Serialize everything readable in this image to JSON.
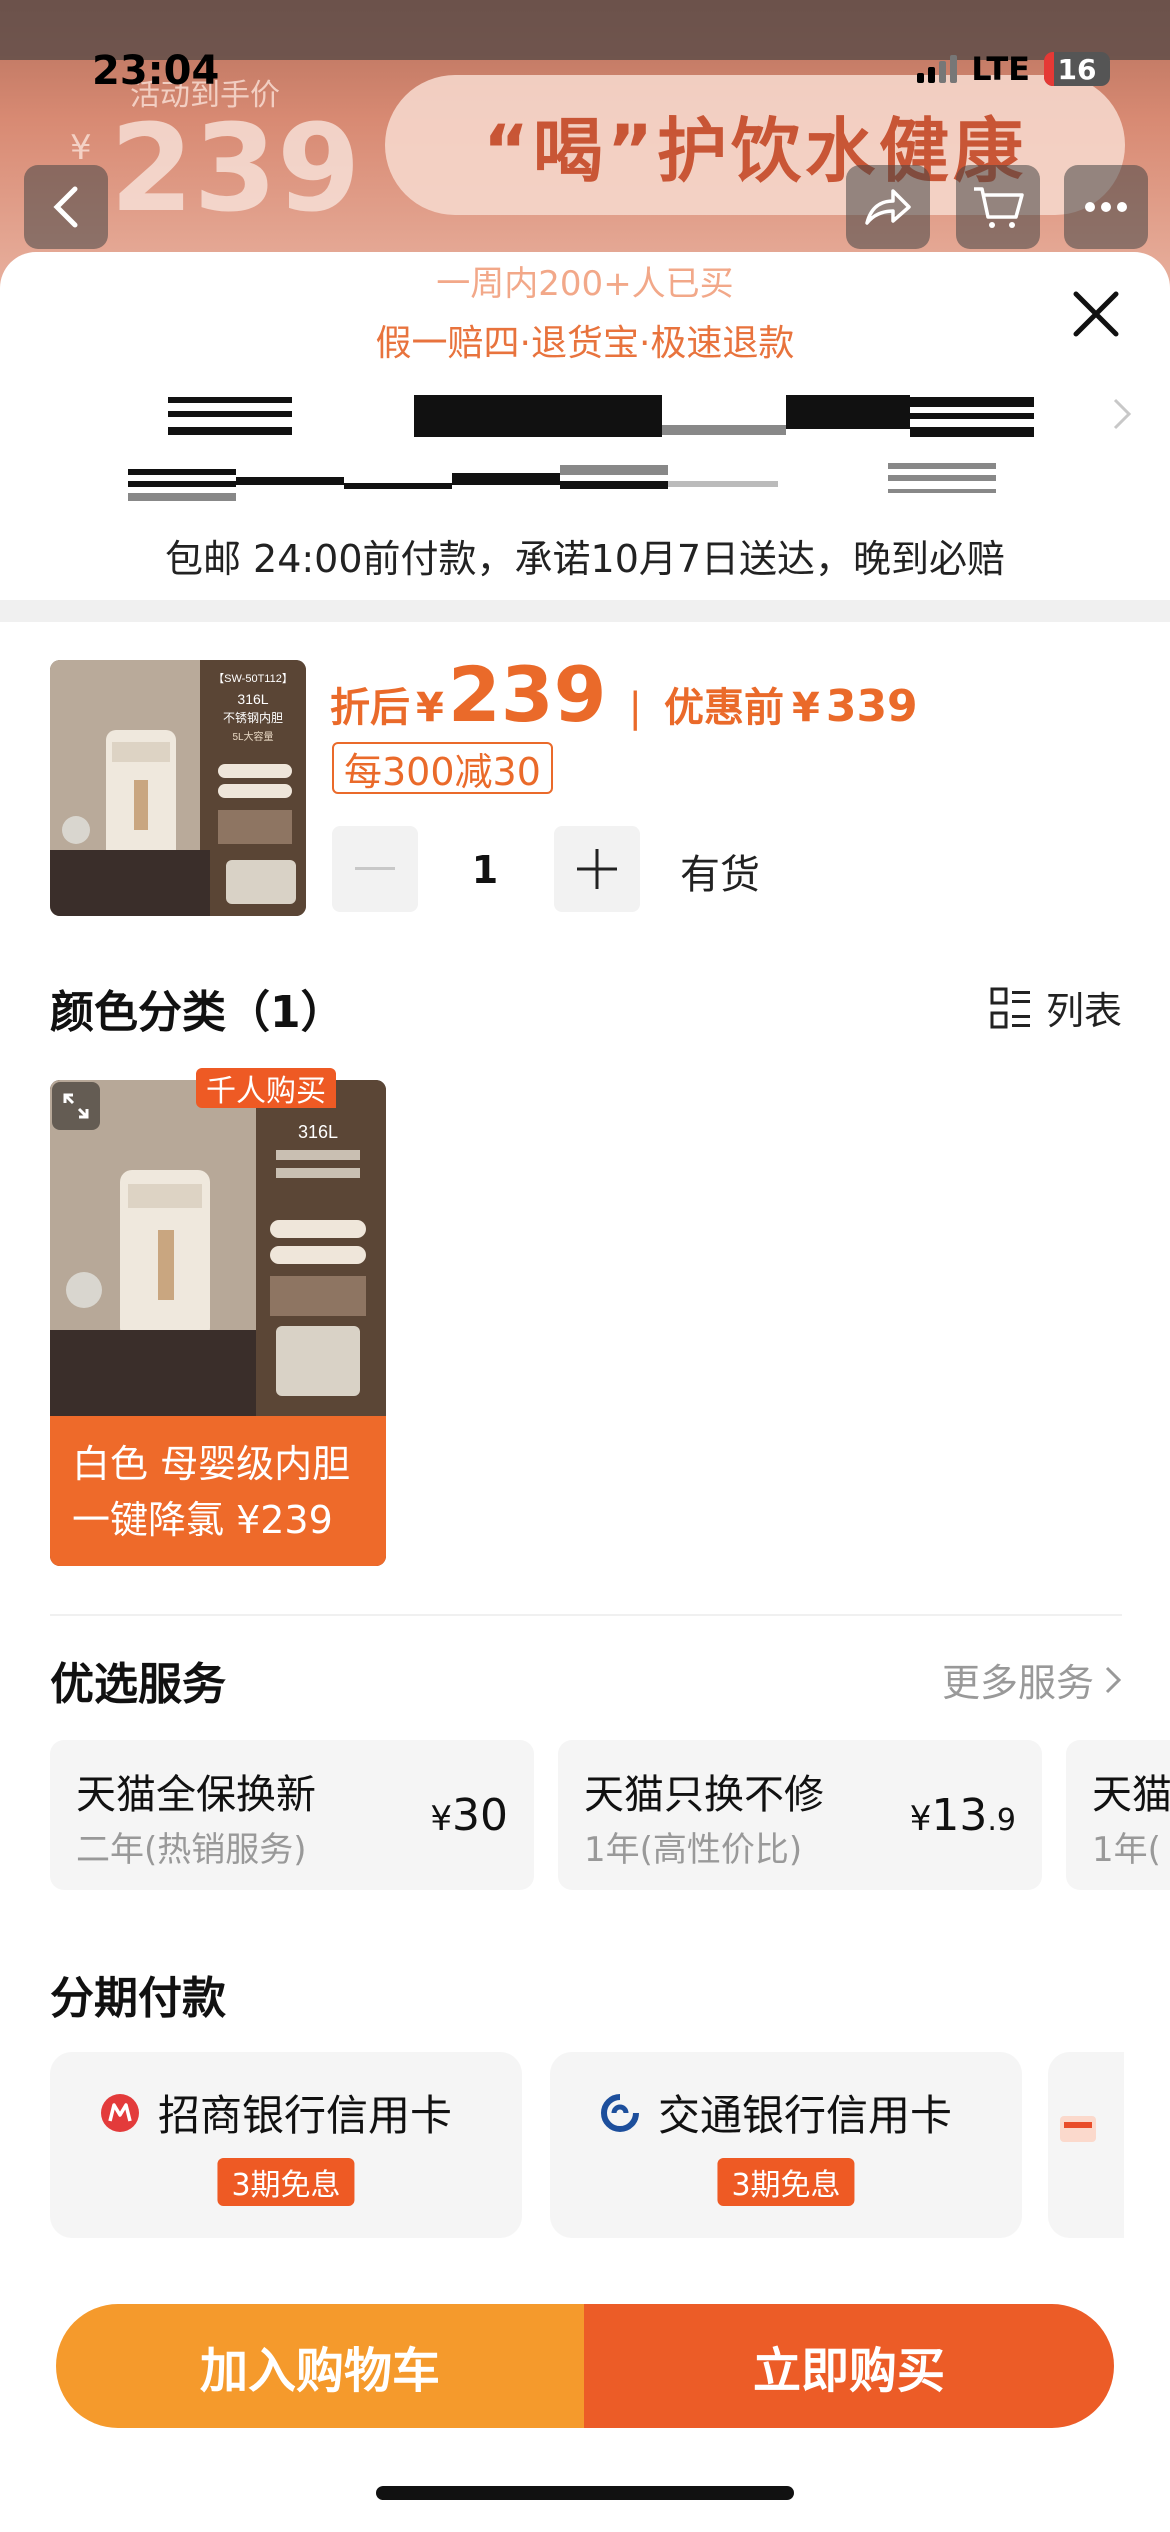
{
  "status_bar": {
    "time": "23:04",
    "network": "LTE",
    "battery": "16"
  },
  "banner": {
    "price_label": "活动到手价",
    "currency": "¥",
    "price": "239",
    "slogan": "“喝”护饮水健康"
  },
  "sheet": {
    "buyers_note": "一周内200+人已买",
    "guarantee": "假一赔四·退货宝·极速退款",
    "delivery": "包邮 24:00前付款，承诺10月7日送达，晚到必赔"
  },
  "product": {
    "after_label": "折后",
    "currency": "¥",
    "price": "239",
    "separator": "|",
    "before_label": "优惠前",
    "before_price": "339",
    "coupon": "每300减30",
    "quantity": "1",
    "stock": "有货",
    "thumb_model": "【SW-50T112】",
    "thumb_line1": "316L",
    "thumb_line2": "不锈钢内胆",
    "thumb_line3": "5L大容量"
  },
  "variants": {
    "title": "颜色分类（1）",
    "list_label": "列表",
    "items": [
      {
        "badge": "千人购买",
        "line1": "白色 母婴级内胆",
        "line2": "一键降氯 ¥239"
      }
    ]
  },
  "services": {
    "title": "优选服务",
    "more": "更多服务",
    "items": [
      {
        "name": "天猫全保换新",
        "desc": "二年(热销服务)",
        "yen": "¥",
        "price": "30",
        "decimal": ""
      },
      {
        "name": "天猫只换不修",
        "desc": "1年(高性价比)",
        "yen": "¥",
        "price": "13",
        "decimal": ".9"
      },
      {
        "name": "天猫",
        "desc": "1年(",
        "yen": "",
        "price": "",
        "decimal": ""
      }
    ]
  },
  "installments": {
    "title": "分期付款",
    "items": [
      {
        "bank": "招商银行信用卡",
        "tag": "3期免息"
      },
      {
        "bank": "交通银行信用卡",
        "tag": "3期免息"
      },
      {
        "bank": "",
        "tag": ""
      }
    ]
  },
  "buttons": {
    "add_to_cart": "加入购物车",
    "buy_now": "立即购买"
  },
  "colors": {
    "accent": "#ea6a2a",
    "cart_button": "#f59a2c",
    "buy_button": "#ec5c27"
  }
}
